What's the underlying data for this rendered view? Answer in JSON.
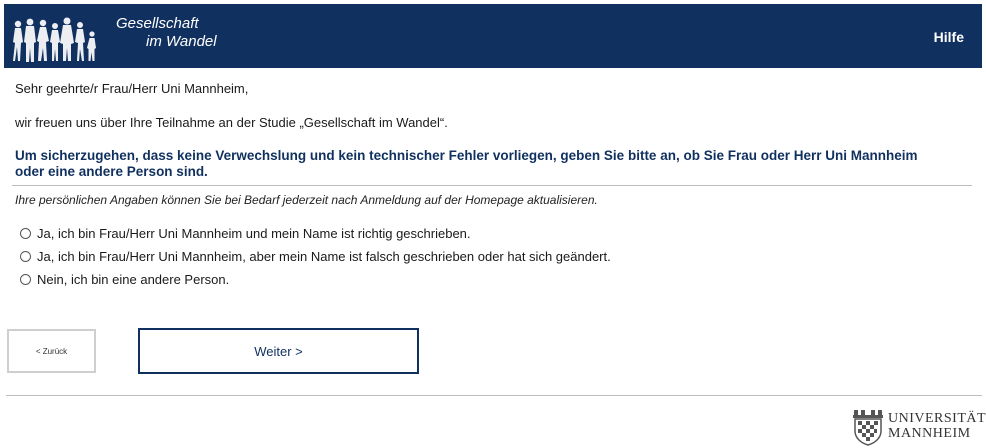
{
  "header": {
    "logo_line1": "Gesellschaft",
    "logo_line2": "im Wandel",
    "help_label": "Hilfe"
  },
  "body": {
    "salutation": "Sehr geehrte/r Frau/Herr Uni Mannheim,",
    "intro": "wir freuen uns über Ihre Teilnahme an der Studie „Gesellschaft im Wandel“.",
    "question": "Um sicherzugehen, dass keine Verwechslung und kein technischer Fehler vorliegen, geben Sie bitte an, ob Sie Frau oder Herr Uni Mannheim oder eine andere Person sind.",
    "hint": "Ihre persönlichen Angaben können Sie bei Bedarf jederzeit nach Anmeldung auf der Homepage aktualisieren.",
    "options": [
      {
        "label": "Ja, ich bin Frau/Herr Uni Mannheim und mein Name ist richtig geschrieben."
      },
      {
        "label": "Ja, ich bin Frau/Herr Uni Mannheim, aber mein Name ist falsch geschrieben oder hat sich geändert."
      },
      {
        "label": "Nein, ich bin eine andere Person."
      }
    ]
  },
  "nav": {
    "back_label": "< Zurück",
    "next_label": "Weiter >"
  },
  "footer": {
    "uni_line1": "UNIVERSITÄT",
    "uni_line2": "MANNHEIM"
  },
  "colors": {
    "header_bg": "#10315f",
    "accent": "#10315f"
  }
}
